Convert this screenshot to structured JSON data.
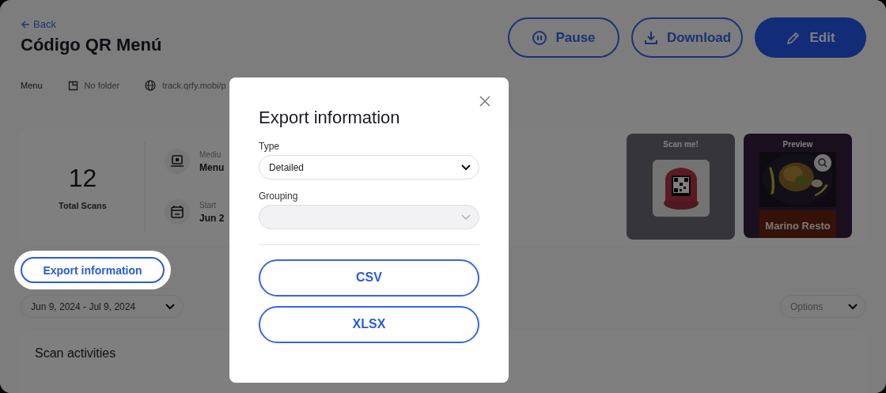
{
  "header": {
    "back": "Back",
    "title": "Código QR Menú",
    "actions": [
      {
        "kind": "pause",
        "label": "Pause"
      },
      {
        "kind": "download",
        "label": "Download"
      },
      {
        "kind": "edit",
        "label": "Edit"
      }
    ]
  },
  "meta": [
    {
      "kind": "plain",
      "text": "Menu"
    },
    {
      "kind": "folder",
      "text": "No folder"
    },
    {
      "kind": "link",
      "text": "track.qrfy.mobi/p"
    }
  ],
  "stats": {
    "total": "12",
    "total_label": "Total Scans",
    "details": [
      {
        "kind": "medium",
        "label": "Mediu",
        "value": "Menu"
      },
      {
        "kind": "date",
        "label": "Start",
        "value": "Jun 2"
      }
    ],
    "scan_label": "Scan me!",
    "preview_label": "Preview",
    "preview_name": "Marino Resto"
  },
  "export_button": "Export information",
  "date_range": "Jun 9, 2024 - Jul 9, 2024",
  "options": {
    "placeholder": "Options"
  },
  "activities_title": "Scan activities",
  "modal": {
    "title": "Export information",
    "fields": [
      {
        "label": "Type",
        "value": "Detailed",
        "disabled": false
      },
      {
        "label": "Grouping",
        "disabled": true
      }
    ],
    "buttons": [
      "CSV",
      "XLSX"
    ]
  }
}
